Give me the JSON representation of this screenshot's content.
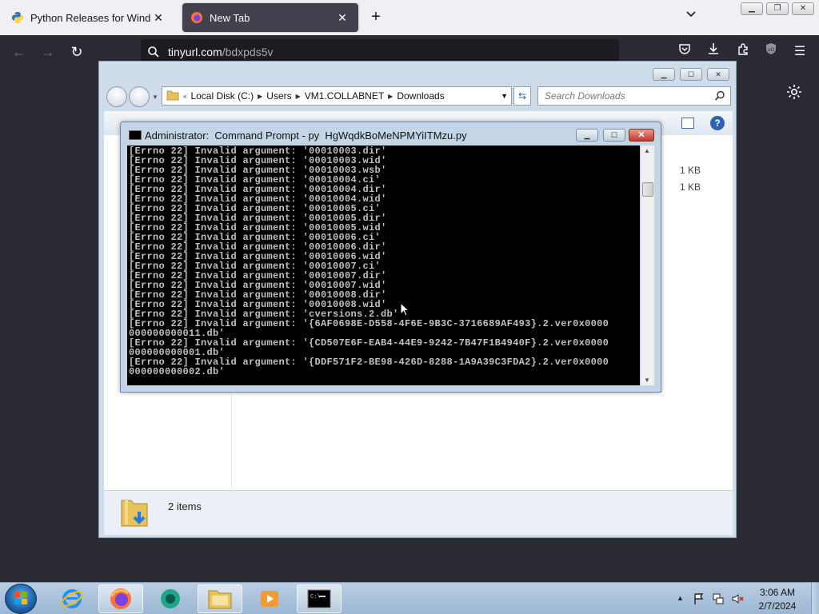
{
  "browser": {
    "tabs": [
      {
        "title": "Python Releases for Windows |",
        "active": false
      },
      {
        "title": "New Tab",
        "active": true
      }
    ],
    "url_host": "tinyurl.com",
    "url_path": "/bdxpds5v",
    "colors": {
      "tabbar_bg": "#f0f0f4",
      "toolbar_bg": "#2b2a33",
      "active_tab": "#42414d"
    }
  },
  "explorer": {
    "breadcrumb": [
      "Local Disk (C:)",
      "Users",
      "VM1.COLLABNET",
      "Downloads"
    ],
    "search_placeholder": "Search Downloads",
    "file_sizes": [
      "1 KB",
      "1 KB"
    ],
    "item_count": "2 items"
  },
  "cmd": {
    "title": "Administrator:  Command Prompt - py  HgWqdkBoMeNPMYiITMzu.py",
    "lines": [
      "[Errno 22] Invalid argument: '00010003.dir'",
      "[Errno 22] Invalid argument: '00010003.wid'",
      "[Errno 22] Invalid argument: '00010003.wsb'",
      "[Errno 22] Invalid argument: '00010004.ci'",
      "[Errno 22] Invalid argument: '00010004.dir'",
      "[Errno 22] Invalid argument: '00010004.wid'",
      "[Errno 22] Invalid argument: '00010005.ci'",
      "[Errno 22] Invalid argument: '00010005.dir'",
      "[Errno 22] Invalid argument: '00010005.wid'",
      "[Errno 22] Invalid argument: '00010006.ci'",
      "[Errno 22] Invalid argument: '00010006.dir'",
      "[Errno 22] Invalid argument: '00010006.wid'",
      "[Errno 22] Invalid argument: '00010007.ci'",
      "[Errno 22] Invalid argument: '00010007.dir'",
      "[Errno 22] Invalid argument: '00010007.wid'",
      "[Errno 22] Invalid argument: '00010008.dir'",
      "[Errno 22] Invalid argument: '00010008.wid'",
      "[Errno 22] Invalid argument: 'cversions.2.db'",
      "[Errno 22] Invalid argument: '{6AF0698E-D558-4F6E-9B3C-3716689AF493}.2.ver0x0000",
      "000000000011.db'",
      "[Errno 22] Invalid argument: '{CD507E6F-EAB4-44E9-9242-7B47F1B4940F}.2.ver0x0000",
      "000000000001.db'",
      "[Errno 22] Invalid argument: '{DDF571F2-BE98-426D-8288-1A9A39C3FDA2}.2.ver0x0000",
      "000000000002.db'"
    ]
  },
  "taskbar": {
    "apps": [
      "ie-icon",
      "firefox-icon",
      "app-icon",
      "explorer-icon",
      "media-player-icon",
      "cmd-icon"
    ],
    "time": "3:06 AM",
    "date": "2/7/2024"
  }
}
